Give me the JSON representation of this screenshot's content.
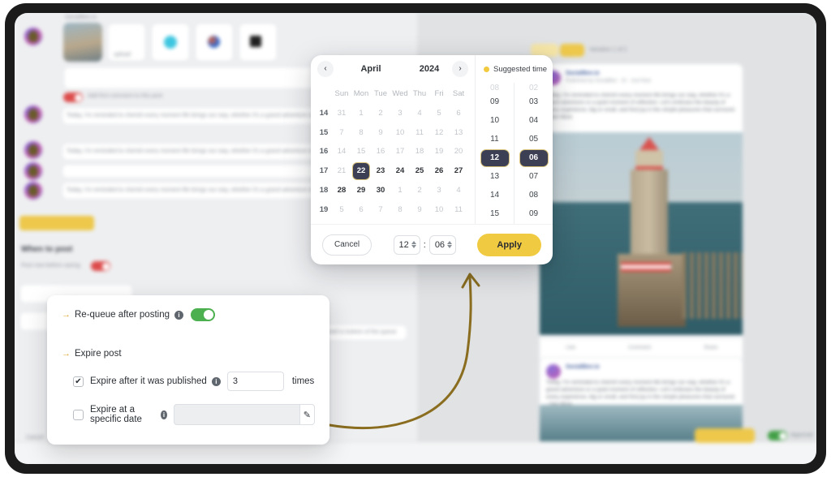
{
  "app": {
    "background_sections": {
      "when_to_post_heading": "When to post",
      "post_now_label": "Post now before saving",
      "add_first_comment": "Add first comment to this post",
      "upload_label": "upload",
      "queue_select_value": "Add to bottom of the queue",
      "save_queue_label": "Save queue",
      "approval_label": "Approval",
      "cancel_label": "Cancel",
      "pagination_label": "Variation 1 of 2",
      "post_body_text": "Today, I'm reminded to cherish every moment life brings our way, whether it's a grand adventure or a quiet moment of reflection. Let's embrace the beauty of every experience, big or small, and find joy in the simple pleasures that surround. - See More",
      "post_author": "SocialBee.io",
      "post_meta": "Published by SocialBee · 1h · Just Now",
      "post_actions": [
        "Like",
        "Comment",
        "Share"
      ]
    }
  },
  "datepicker": {
    "prev_label": "‹",
    "next_label": "›",
    "month": "April",
    "year": "2024",
    "weekday_headers": [
      "Sun",
      "Mon",
      "Tue",
      "Wed",
      "Thu",
      "Fri",
      "Sat"
    ],
    "week_numbers": [
      "14",
      "15",
      "16",
      "17",
      "18",
      "19"
    ],
    "weeks": [
      [
        {
          "d": "31",
          "in_month": false,
          "selected": false
        },
        {
          "d": "1",
          "in_month": false,
          "selected": false
        },
        {
          "d": "2",
          "in_month": false,
          "selected": false
        },
        {
          "d": "3",
          "in_month": false,
          "selected": false
        },
        {
          "d": "4",
          "in_month": false,
          "selected": false
        },
        {
          "d": "5",
          "in_month": false,
          "selected": false
        },
        {
          "d": "6",
          "in_month": false,
          "selected": false
        }
      ],
      [
        {
          "d": "7",
          "in_month": false,
          "selected": false
        },
        {
          "d": "8",
          "in_month": false,
          "selected": false
        },
        {
          "d": "9",
          "in_month": false,
          "selected": false
        },
        {
          "d": "10",
          "in_month": false,
          "selected": false
        },
        {
          "d": "11",
          "in_month": false,
          "selected": false
        },
        {
          "d": "12",
          "in_month": false,
          "selected": false
        },
        {
          "d": "13",
          "in_month": false,
          "selected": false
        }
      ],
      [
        {
          "d": "14",
          "in_month": false,
          "selected": false
        },
        {
          "d": "15",
          "in_month": false,
          "selected": false
        },
        {
          "d": "16",
          "in_month": false,
          "selected": false
        },
        {
          "d": "17",
          "in_month": false,
          "selected": false
        },
        {
          "d": "18",
          "in_month": false,
          "selected": false
        },
        {
          "d": "19",
          "in_month": false,
          "selected": false
        },
        {
          "d": "20",
          "in_month": false,
          "selected": false
        }
      ],
      [
        {
          "d": "21",
          "in_month": false,
          "selected": false
        },
        {
          "d": "22",
          "in_month": true,
          "selected": true
        },
        {
          "d": "23",
          "in_month": true,
          "selected": false
        },
        {
          "d": "24",
          "in_month": true,
          "selected": false
        },
        {
          "d": "25",
          "in_month": true,
          "selected": false
        },
        {
          "d": "26",
          "in_month": true,
          "selected": false
        },
        {
          "d": "27",
          "in_month": true,
          "selected": false
        }
      ],
      [
        {
          "d": "28",
          "in_month": true,
          "selected": false
        },
        {
          "d": "29",
          "in_month": true,
          "selected": false
        },
        {
          "d": "30",
          "in_month": true,
          "selected": false
        },
        {
          "d": "1",
          "in_month": false,
          "selected": false
        },
        {
          "d": "2",
          "in_month": false,
          "selected": false
        },
        {
          "d": "3",
          "in_month": false,
          "selected": false
        },
        {
          "d": "4",
          "in_month": false,
          "selected": false
        }
      ],
      [
        {
          "d": "5",
          "in_month": false,
          "selected": false
        },
        {
          "d": "6",
          "in_month": false,
          "selected": false
        },
        {
          "d": "7",
          "in_month": false,
          "selected": false
        },
        {
          "d": "8",
          "in_month": false,
          "selected": false
        },
        {
          "d": "9",
          "in_month": false,
          "selected": false
        },
        {
          "d": "10",
          "in_month": false,
          "selected": false
        },
        {
          "d": "11",
          "in_month": false,
          "selected": false
        }
      ]
    ],
    "suggested_time_label": "Suggested time",
    "hours": [
      "08",
      "09",
      "10",
      "11",
      "12",
      "13",
      "14",
      "15"
    ],
    "selected_hour": "12",
    "minutes": [
      "02",
      "03",
      "04",
      "05",
      "06",
      "07",
      "08",
      "09"
    ],
    "selected_minute": "06",
    "footer": {
      "cancel_label": "Cancel",
      "hour_value": "12",
      "minute_value": "06",
      "separator": ":",
      "apply_label": "Apply"
    },
    "accent_color": "#f0cb41",
    "selected_bg": "#3d4055"
  },
  "expire_panel": {
    "requeue_label": "Re-queue after posting",
    "requeue_enabled": true,
    "expire_post_heading": "Expire post",
    "expire_after_published_label": "Expire after it was published",
    "expire_after_published_checked": true,
    "times_value": "3",
    "times_unit": "times",
    "expire_specific_date_label": "Expire at a specific date",
    "expire_specific_date_checked": false,
    "specific_date_value": "",
    "info_glyph": "i",
    "check_glyph": "✔",
    "arrow_glyph": "→",
    "edit_glyph": "✎",
    "toggle_on_color": "#4caf50"
  },
  "annotation": {
    "arrow_color": "#8a6d1f"
  }
}
